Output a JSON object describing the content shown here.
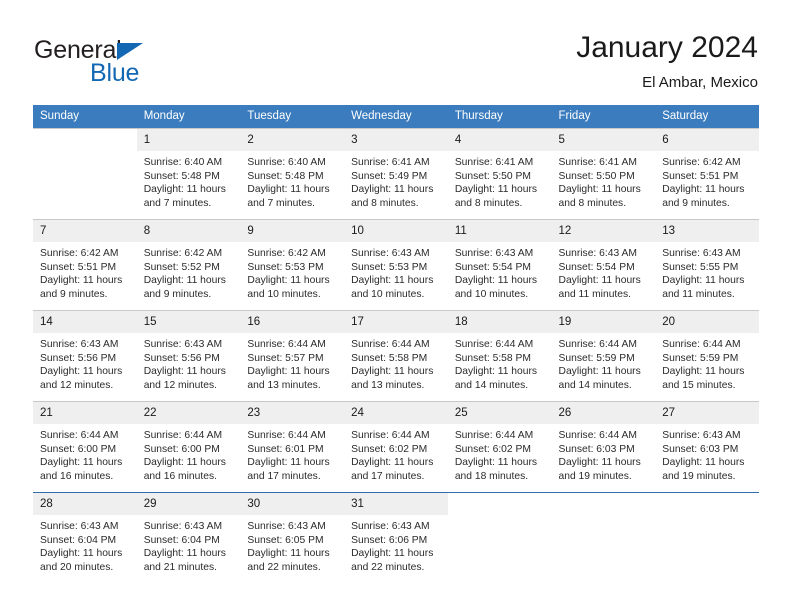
{
  "brand": {
    "name_part1": "General",
    "name_part2": "Blue",
    "logo_icon": "triangle-icon",
    "colors": {
      "blue": "#1268b3",
      "dark": "#231f20"
    }
  },
  "header": {
    "title": "January 2024",
    "location": "El Ambar, Mexico"
  },
  "theme": {
    "header_row_bg": "#3a7cbe",
    "daynum_bg": "#efefef",
    "grid_line": "#c8c8c8",
    "last_week_line": "#2f6fb0"
  },
  "calendar": {
    "weekdays": [
      "Sunday",
      "Monday",
      "Tuesday",
      "Wednesday",
      "Thursday",
      "Friday",
      "Saturday"
    ],
    "weeks": [
      [
        {
          "day": ""
        },
        {
          "day": "1",
          "sunrise": "Sunrise: 6:40 AM",
          "sunset": "Sunset: 5:48 PM",
          "daylight_line1": "Daylight: 11 hours",
          "daylight_line2": "and 7 minutes."
        },
        {
          "day": "2",
          "sunrise": "Sunrise: 6:40 AM",
          "sunset": "Sunset: 5:48 PM",
          "daylight_line1": "Daylight: 11 hours",
          "daylight_line2": "and 7 minutes."
        },
        {
          "day": "3",
          "sunrise": "Sunrise: 6:41 AM",
          "sunset": "Sunset: 5:49 PM",
          "daylight_line1": "Daylight: 11 hours",
          "daylight_line2": "and 8 minutes."
        },
        {
          "day": "4",
          "sunrise": "Sunrise: 6:41 AM",
          "sunset": "Sunset: 5:50 PM",
          "daylight_line1": "Daylight: 11 hours",
          "daylight_line2": "and 8 minutes."
        },
        {
          "day": "5",
          "sunrise": "Sunrise: 6:41 AM",
          "sunset": "Sunset: 5:50 PM",
          "daylight_line1": "Daylight: 11 hours",
          "daylight_line2": "and 8 minutes."
        },
        {
          "day": "6",
          "sunrise": "Sunrise: 6:42 AM",
          "sunset": "Sunset: 5:51 PM",
          "daylight_line1": "Daylight: 11 hours",
          "daylight_line2": "and 9 minutes."
        }
      ],
      [
        {
          "day": "7",
          "sunrise": "Sunrise: 6:42 AM",
          "sunset": "Sunset: 5:51 PM",
          "daylight_line1": "Daylight: 11 hours",
          "daylight_line2": "and 9 minutes."
        },
        {
          "day": "8",
          "sunrise": "Sunrise: 6:42 AM",
          "sunset": "Sunset: 5:52 PM",
          "daylight_line1": "Daylight: 11 hours",
          "daylight_line2": "and 9 minutes."
        },
        {
          "day": "9",
          "sunrise": "Sunrise: 6:42 AM",
          "sunset": "Sunset: 5:53 PM",
          "daylight_line1": "Daylight: 11 hours",
          "daylight_line2": "and 10 minutes."
        },
        {
          "day": "10",
          "sunrise": "Sunrise: 6:43 AM",
          "sunset": "Sunset: 5:53 PM",
          "daylight_line1": "Daylight: 11 hours",
          "daylight_line2": "and 10 minutes."
        },
        {
          "day": "11",
          "sunrise": "Sunrise: 6:43 AM",
          "sunset": "Sunset: 5:54 PM",
          "daylight_line1": "Daylight: 11 hours",
          "daylight_line2": "and 10 minutes."
        },
        {
          "day": "12",
          "sunrise": "Sunrise: 6:43 AM",
          "sunset": "Sunset: 5:54 PM",
          "daylight_line1": "Daylight: 11 hours",
          "daylight_line2": "and 11 minutes."
        },
        {
          "day": "13",
          "sunrise": "Sunrise: 6:43 AM",
          "sunset": "Sunset: 5:55 PM",
          "daylight_line1": "Daylight: 11 hours",
          "daylight_line2": "and 11 minutes."
        }
      ],
      [
        {
          "day": "14",
          "sunrise": "Sunrise: 6:43 AM",
          "sunset": "Sunset: 5:56 PM",
          "daylight_line1": "Daylight: 11 hours",
          "daylight_line2": "and 12 minutes."
        },
        {
          "day": "15",
          "sunrise": "Sunrise: 6:43 AM",
          "sunset": "Sunset: 5:56 PM",
          "daylight_line1": "Daylight: 11 hours",
          "daylight_line2": "and 12 minutes."
        },
        {
          "day": "16",
          "sunrise": "Sunrise: 6:44 AM",
          "sunset": "Sunset: 5:57 PM",
          "daylight_line1": "Daylight: 11 hours",
          "daylight_line2": "and 13 minutes."
        },
        {
          "day": "17",
          "sunrise": "Sunrise: 6:44 AM",
          "sunset": "Sunset: 5:58 PM",
          "daylight_line1": "Daylight: 11 hours",
          "daylight_line2": "and 13 minutes."
        },
        {
          "day": "18",
          "sunrise": "Sunrise: 6:44 AM",
          "sunset": "Sunset: 5:58 PM",
          "daylight_line1": "Daylight: 11 hours",
          "daylight_line2": "and 14 minutes."
        },
        {
          "day": "19",
          "sunrise": "Sunrise: 6:44 AM",
          "sunset": "Sunset: 5:59 PM",
          "daylight_line1": "Daylight: 11 hours",
          "daylight_line2": "and 14 minutes."
        },
        {
          "day": "20",
          "sunrise": "Sunrise: 6:44 AM",
          "sunset": "Sunset: 5:59 PM",
          "daylight_line1": "Daylight: 11 hours",
          "daylight_line2": "and 15 minutes."
        }
      ],
      [
        {
          "day": "21",
          "sunrise": "Sunrise: 6:44 AM",
          "sunset": "Sunset: 6:00 PM",
          "daylight_line1": "Daylight: 11 hours",
          "daylight_line2": "and 16 minutes."
        },
        {
          "day": "22",
          "sunrise": "Sunrise: 6:44 AM",
          "sunset": "Sunset: 6:00 PM",
          "daylight_line1": "Daylight: 11 hours",
          "daylight_line2": "and 16 minutes."
        },
        {
          "day": "23",
          "sunrise": "Sunrise: 6:44 AM",
          "sunset": "Sunset: 6:01 PM",
          "daylight_line1": "Daylight: 11 hours",
          "daylight_line2": "and 17 minutes."
        },
        {
          "day": "24",
          "sunrise": "Sunrise: 6:44 AM",
          "sunset": "Sunset: 6:02 PM",
          "daylight_line1": "Daylight: 11 hours",
          "daylight_line2": "and 17 minutes."
        },
        {
          "day": "25",
          "sunrise": "Sunrise: 6:44 AM",
          "sunset": "Sunset: 6:02 PM",
          "daylight_line1": "Daylight: 11 hours",
          "daylight_line2": "and 18 minutes."
        },
        {
          "day": "26",
          "sunrise": "Sunrise: 6:44 AM",
          "sunset": "Sunset: 6:03 PM",
          "daylight_line1": "Daylight: 11 hours",
          "daylight_line2": "and 19 minutes."
        },
        {
          "day": "27",
          "sunrise": "Sunrise: 6:43 AM",
          "sunset": "Sunset: 6:03 PM",
          "daylight_line1": "Daylight: 11 hours",
          "daylight_line2": "and 19 minutes."
        }
      ],
      [
        {
          "day": "28",
          "sunrise": "Sunrise: 6:43 AM",
          "sunset": "Sunset: 6:04 PM",
          "daylight_line1": "Daylight: 11 hours",
          "daylight_line2": "and 20 minutes."
        },
        {
          "day": "29",
          "sunrise": "Sunrise: 6:43 AM",
          "sunset": "Sunset: 6:04 PM",
          "daylight_line1": "Daylight: 11 hours",
          "daylight_line2": "and 21 minutes."
        },
        {
          "day": "30",
          "sunrise": "Sunrise: 6:43 AM",
          "sunset": "Sunset: 6:05 PM",
          "daylight_line1": "Daylight: 11 hours",
          "daylight_line2": "and 22 minutes."
        },
        {
          "day": "31",
          "sunrise": "Sunrise: 6:43 AM",
          "sunset": "Sunset: 6:06 PM",
          "daylight_line1": "Daylight: 11 hours",
          "daylight_line2": "and 22 minutes."
        },
        {
          "day": ""
        },
        {
          "day": ""
        },
        {
          "day": ""
        }
      ]
    ]
  }
}
